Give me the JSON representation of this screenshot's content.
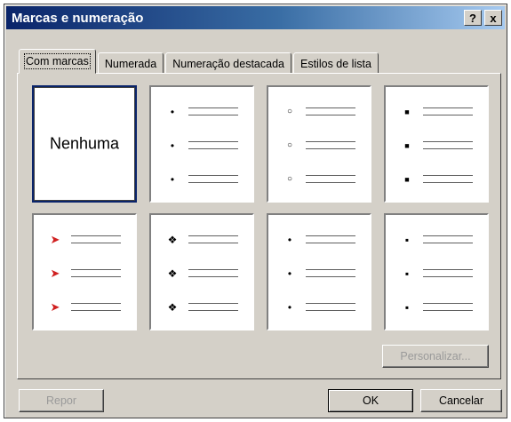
{
  "window": {
    "title": "Marcas e numeração",
    "help_label": "?",
    "close_label": "x"
  },
  "tabs": [
    {
      "label": "Com marcas",
      "active": true
    },
    {
      "label": "Numerada",
      "active": false
    },
    {
      "label": "Numeração destacada",
      "active": false
    },
    {
      "label": "Estilos de lista",
      "active": false
    }
  ],
  "gallery": {
    "none_label": "Nenhuma",
    "styles": [
      {
        "name": "none",
        "selected": true,
        "bullet": ""
      },
      {
        "name": "small-dot",
        "selected": false,
        "bullet": "•"
      },
      {
        "name": "hollow-circle",
        "selected": false,
        "bullet": "○"
      },
      {
        "name": "square",
        "selected": false,
        "bullet": "■"
      },
      {
        "name": "colored-arrow",
        "selected": false,
        "bullet": "➤"
      },
      {
        "name": "diamond-dots",
        "selected": false,
        "bullet": "❖"
      },
      {
        "name": "dot",
        "selected": false,
        "bullet": "•"
      },
      {
        "name": "small-square",
        "selected": false,
        "bullet": "▪"
      }
    ]
  },
  "buttons": {
    "personalizar": "Personalizar...",
    "repor": "Repor",
    "ok": "OK",
    "cancelar": "Cancelar"
  },
  "colors": {
    "title_bar": "#0a246a",
    "selection_border": "#0a246a",
    "dialog_bg": "#d4d0c8"
  }
}
